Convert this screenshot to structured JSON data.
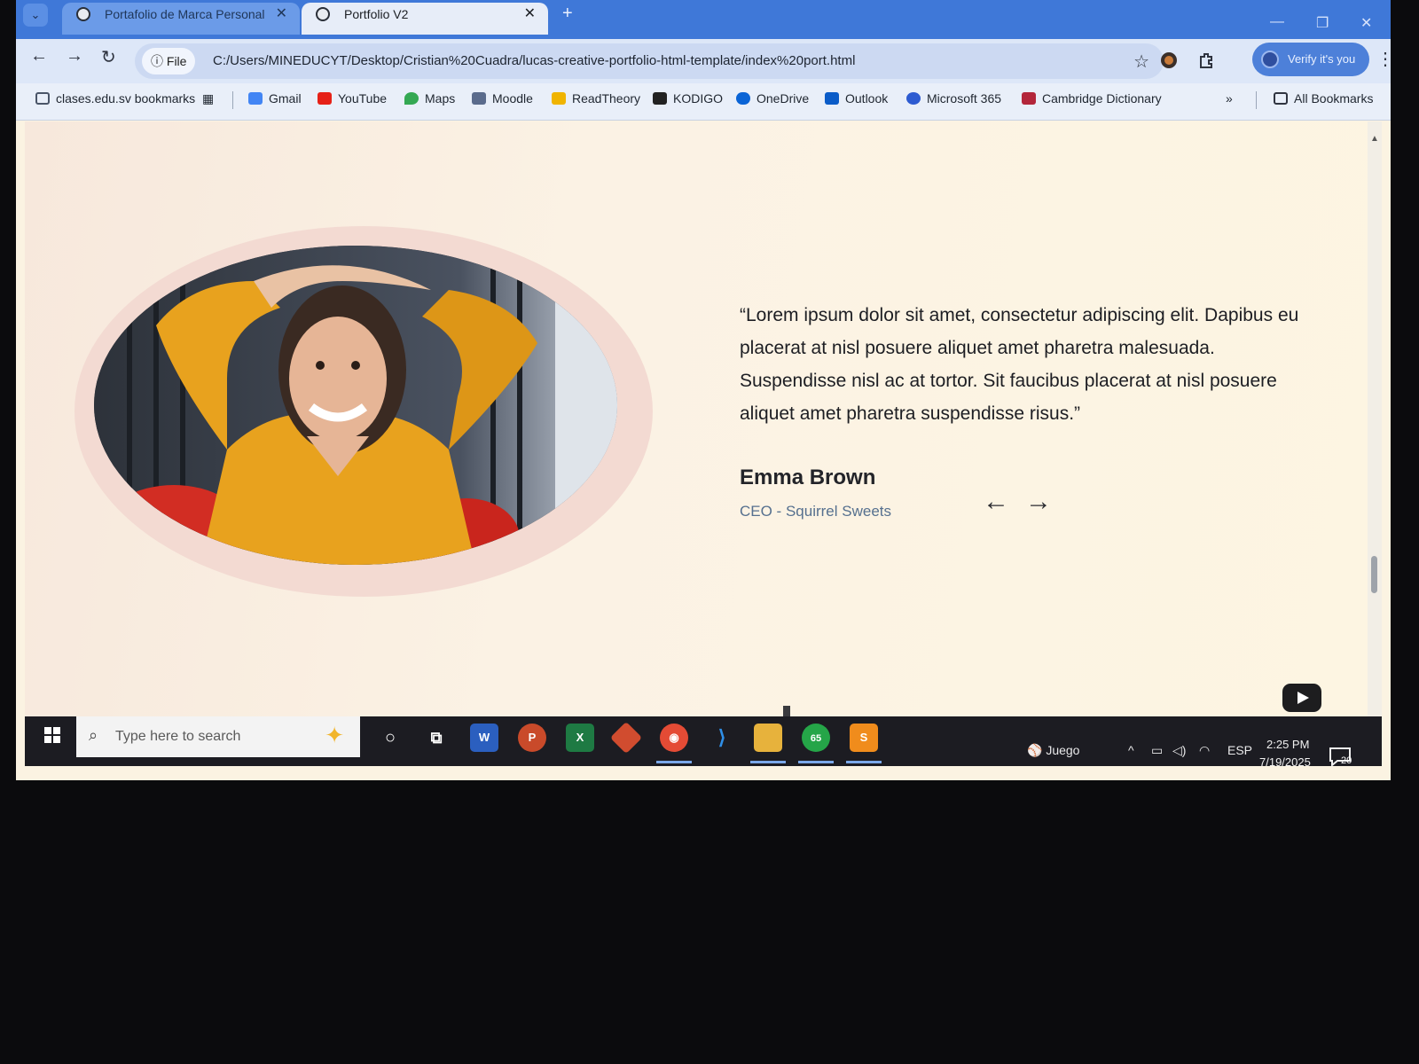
{
  "browser": {
    "tabs": [
      {
        "title": "Portafolio de Marca Personal"
      },
      {
        "title": "Portfolio V2"
      }
    ],
    "file_chip": "File",
    "url": "C:/Users/MINEDUCYT/Desktop/Cristian%20Cuadra/lucas-creative-portfolio-html-template/index%20port.html",
    "verify_label": "Verify it's you",
    "bookmarks": [
      {
        "label": "clases.edu.sv bookmarks",
        "color": "#4a5568"
      },
      {
        "label": "Gmail",
        "color": "#4285f4"
      },
      {
        "label": "YouTube",
        "color": "#e62117"
      },
      {
        "label": "Maps",
        "color": "#34a853"
      },
      {
        "label": "Moodle",
        "color": "#5a6b8c"
      },
      {
        "label": "ReadTheory",
        "color": "#f0b400"
      },
      {
        "label": "KODIGO",
        "color": "#222222"
      },
      {
        "label": "OneDrive",
        "color": "#0a64d6"
      },
      {
        "label": "Outlook",
        "color": "#0b5cc8"
      },
      {
        "label": "Microsoft 365",
        "color": "#2d5bd1"
      },
      {
        "label": "Cambridge Dictionary",
        "color": "#b3263b"
      }
    ],
    "all_bookmarks": "All Bookmarks"
  },
  "testimonial": {
    "quote": "“Lorem ipsum dolor sit amet, consectetur adipiscing elit. Dapibus eu placerat at nisl posuere aliquet amet pharetra malesuada. Suspendisse nisl ac at tortor. Sit faucibus placerat at nisl posuere aliquet amet pharetra suspendisse risus.”",
    "author": "Emma Brown",
    "role": "CEO - Squirrel Sweets",
    "prev_icon": "arrow-left-icon",
    "next_icon": "arrow-right-icon"
  },
  "taskbar": {
    "search_placeholder": "Type here to search",
    "whatsapp_badge": "65",
    "weather_label": "Juego",
    "language": "ESP",
    "time": "2:25 PM",
    "date": "7/19/2025",
    "notifications": "20"
  },
  "colors": {
    "accent": "#3f78d8",
    "page_bg": "#fbf2e4",
    "role_text": "#56708f"
  }
}
